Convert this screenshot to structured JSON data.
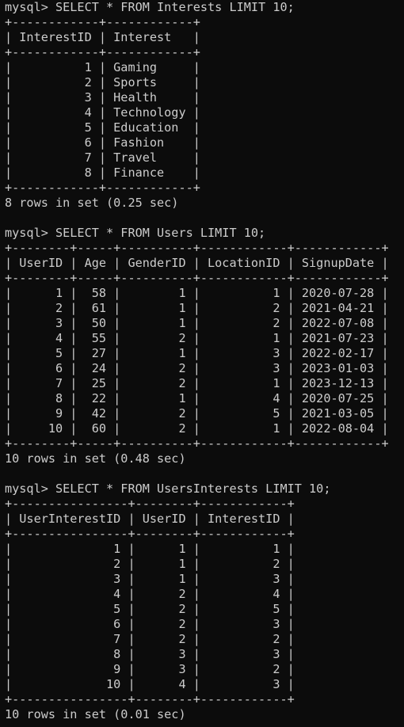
{
  "colors": {
    "background": "#0c0c0c",
    "foreground": "#cccccc"
  },
  "blocks": [
    {
      "command": "mysql> SELECT * FROM Interests LIMIT 10;",
      "table_lines": [
        "+------------+------------+",
        "| InterestID | Interest   |",
        "+------------+------------+",
        "|          1 | Gaming     |",
        "|          2 | Sports     |",
        "|          3 | Health     |",
        "|          4 | Technology |",
        "|          5 | Education  |",
        "|          6 | Fashion    |",
        "|          7 | Travel     |",
        "|          8 | Finance    |",
        "+------------+------------+"
      ],
      "result": "8 rows in set (0.25 sec)"
    },
    {
      "command": "mysql> SELECT * FROM Users LIMIT 10;",
      "table_lines": [
        "+--------+-----+----------+------------+------------+",
        "| UserID | Age | GenderID | LocationID | SignupDate |",
        "+--------+-----+----------+------------+------------+",
        "|      1 |  58 |        1 |          1 | 2020-07-28 |",
        "|      2 |  61 |        1 |          2 | 2021-04-21 |",
        "|      3 |  50 |        1 |          2 | 2022-07-08 |",
        "|      4 |  55 |        2 |          1 | 2021-07-23 |",
        "|      5 |  27 |        1 |          3 | 2022-02-17 |",
        "|      6 |  24 |        2 |          3 | 2023-01-03 |",
        "|      7 |  25 |        2 |          1 | 2023-12-13 |",
        "|      8 |  22 |        1 |          4 | 2020-07-25 |",
        "|      9 |  42 |        2 |          5 | 2021-03-05 |",
        "|     10 |  60 |        2 |          1 | 2022-08-04 |",
        "+--------+-----+----------+------------+------------+"
      ],
      "result": "10 rows in set (0.48 sec)"
    },
    {
      "command": "mysql> SELECT * FROM UsersInterests LIMIT 10;",
      "table_lines": [
        "+----------------+--------+------------+",
        "| UserInterestID | UserID | InterestID |",
        "+----------------+--------+------------+",
        "|              1 |      1 |          1 |",
        "|              2 |      1 |          2 |",
        "|              3 |      1 |          3 |",
        "|              4 |      2 |          4 |",
        "|              5 |      2 |          5 |",
        "|              6 |      2 |          3 |",
        "|              7 |      2 |          2 |",
        "|              8 |      3 |          3 |",
        "|              9 |      3 |          2 |",
        "|             10 |      4 |          3 |",
        "+----------------+--------+------------+"
      ],
      "result": "10 rows in set (0.01 sec)"
    }
  ]
}
